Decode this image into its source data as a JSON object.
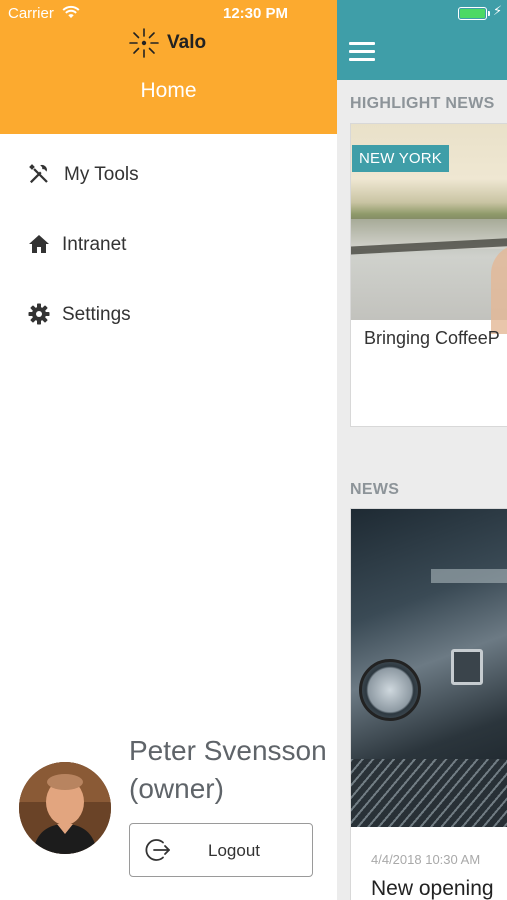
{
  "status_bar": {
    "carrier": "Carrier",
    "time": "12:30 PM",
    "battery_level": 1.0
  },
  "drawer": {
    "logo_text": "Valo",
    "header_title": "Home",
    "menu": [
      {
        "label": "My Tools",
        "icon": "tools-icon"
      },
      {
        "label": "Intranet",
        "icon": "home-icon"
      },
      {
        "label": "Settings",
        "icon": "gear-icon"
      }
    ],
    "user": {
      "name": "Peter Svensson",
      "role": "(owner)"
    },
    "logout_label": "Logout"
  },
  "content": {
    "highlight_section_title": "HIGHLIGHT NEWS",
    "highlight_tag": "NEW YORK",
    "highlight_caption": "Bringing CoffeeP",
    "news_section_title": "NEWS",
    "news_date": "4/4/2018 10:30 AM",
    "news_caption": "New opening"
  },
  "colors": {
    "drawer_header": "#fcaa2f",
    "content_header": "#3f9ea8",
    "tag_background": "#3f9ea8",
    "battery": "#4cd964"
  }
}
